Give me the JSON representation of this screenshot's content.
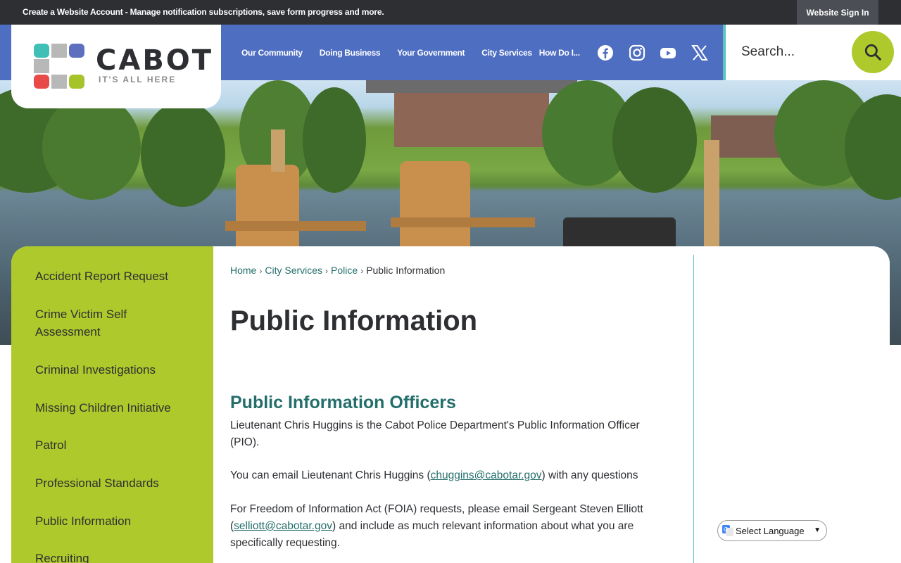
{
  "topbar": {
    "message": "Create a Website Account - Manage notification subscriptions, save form progress and more.",
    "signin_label": "Website Sign In"
  },
  "logo": {
    "name": "CABOT",
    "tagline": "IT'S ALL HERE"
  },
  "nav": {
    "items": [
      "Our Community",
      "Doing Business",
      "Your Government",
      "City Services",
      "How Do I..."
    ]
  },
  "social": {
    "icons": [
      "facebook-icon",
      "instagram-icon",
      "youtube-icon",
      "x-twitter-icon"
    ]
  },
  "search": {
    "placeholder": "Search..."
  },
  "sidebar": {
    "items": [
      {
        "label": "Accident Report Request"
      },
      {
        "label": "Crime Victim Self Assessment"
      },
      {
        "label": "Criminal Investigations"
      },
      {
        "label": "Missing Children Initiative"
      },
      {
        "label": "Patrol"
      },
      {
        "label": "Professional Standards"
      },
      {
        "label": "Public Information"
      },
      {
        "label": "Recruiting"
      }
    ]
  },
  "breadcrumb": {
    "home": "Home",
    "city_services": "City Services",
    "police": "Police",
    "current": "Public Information",
    "separator": "›"
  },
  "page": {
    "title": "Public Information",
    "section_heading": "Public Information Officers",
    "para1": "Lieutenant Chris Huggins is the Cabot Police Department's Public Information Officer (PIO).",
    "para2_before": "You can email Lieutenant Chris Huggins (",
    "para2_email": "chuggins@cabotar.gov",
    "para2_after": ") with any questions",
    "para3_before": "For Freedom of Information Act (FOIA) requests, please email Sergeant Steven Elliott (",
    "para3_email": "selliott@cabotar.gov",
    "para3_after": ") and include as much relevant information about what you are specifically requesting."
  },
  "language": {
    "label": "Select Language"
  },
  "colors": {
    "header_blue": "#4e6ec2",
    "sidebar_green": "#adc92b",
    "link_teal": "#236e6b",
    "accent_teal": "#5bc4bf",
    "topbar_dark": "#2d2f33"
  }
}
